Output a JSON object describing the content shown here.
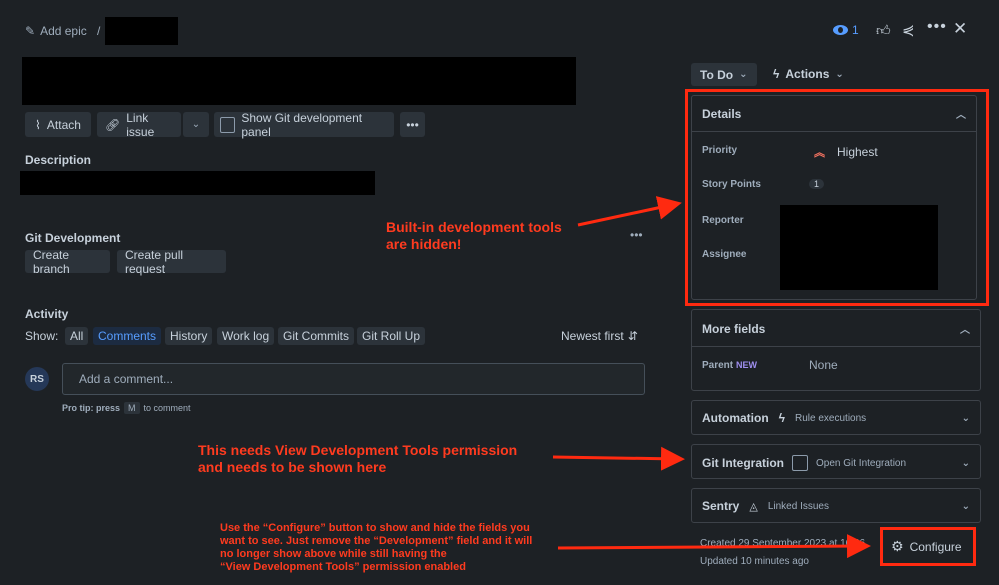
{
  "header": {
    "add_epic": "Add epic",
    "separator": "/",
    "watch_count": "1"
  },
  "toolbar": {
    "attach": "Attach",
    "link_issue": "Link issue",
    "show_git_panel": "Show Git development panel"
  },
  "description": {
    "heading": "Description"
  },
  "git_development": {
    "heading": "Git Development",
    "create_branch": "Create branch",
    "create_pull_request": "Create pull request"
  },
  "activity": {
    "heading": "Activity",
    "show_label": "Show:",
    "tabs": [
      "All",
      "Comments",
      "History",
      "Work log",
      "Git Commits",
      "Git Roll Up"
    ],
    "sort": "Newest first",
    "avatar_initials": "RS",
    "comment_placeholder": "Add a comment...",
    "protip_prefix": "Pro tip: press",
    "protip_key": "M",
    "protip_suffix": "to comment"
  },
  "sidebar": {
    "status": "To Do",
    "actions": "Actions",
    "details": {
      "heading": "Details",
      "priority_label": "Priority",
      "priority_value": "Highest",
      "story_points_label": "Story Points",
      "story_points_value": "1",
      "reporter_label": "Reporter",
      "assignee_label": "Assignee"
    },
    "more_fields": {
      "heading": "More fields",
      "parent_label": "Parent",
      "parent_badge": "NEW",
      "parent_value": "None"
    },
    "automation": {
      "heading": "Automation",
      "sub": "Rule executions"
    },
    "git_integration": {
      "heading": "Git Integration",
      "sub": "Open Git Integration"
    },
    "sentry": {
      "heading": "Sentry",
      "sub": "Linked Issues"
    },
    "created": "Created 29 September 2023 at 16:06",
    "updated": "Updated 10 minutes ago",
    "configure": "Configure"
  },
  "annotations": {
    "builtin_line1": "Built-in development tools",
    "builtin_line2": "are hidden!",
    "permission_line1": "This needs View Development Tools permission",
    "permission_line2": "and needs to be shown here",
    "configure_line1": "Use the “Configure” button to show and hide the fields you",
    "configure_line2": "want to see. Just remove the “Development” field and it will",
    "configure_line3": "no longer show above while still having the",
    "configure_line4": "“View Development Tools” permission enabled"
  },
  "colors": {
    "background": "#1d2125",
    "annotation_red": "#ff3b1f",
    "link_blue": "#579dff",
    "priority_red": "#f87462"
  }
}
